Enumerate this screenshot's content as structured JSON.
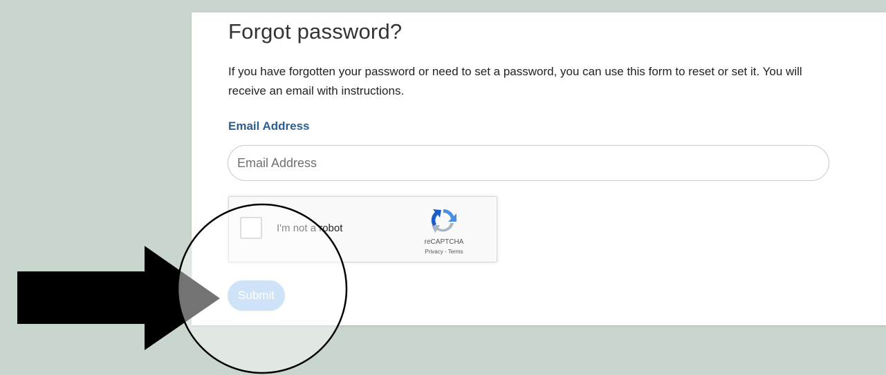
{
  "form": {
    "title": "Forgot password?",
    "description": "If you have forgotten your password or need to set a password, you can use this form to reset or set it. You will receive an email with instructions.",
    "email_label": "Email Address",
    "email_placeholder": "Email Address",
    "email_value": "",
    "submit_label": "Submit"
  },
  "recaptcha": {
    "checkbox_label": "I'm not a robot",
    "brand": "reCAPTCHA",
    "privacy_label": "Privacy",
    "separator": "-",
    "terms_label": "Terms",
    "checked": false
  },
  "icons": {
    "recaptcha_logo": "recaptcha-logo-icon",
    "annotation_arrow": "arrow-right-icon",
    "annotation_circle": "highlight-circle"
  },
  "colors": {
    "page_background": "#c9d6ce",
    "label_blue": "#2b5f8f",
    "submit_button": "#a7cdf0",
    "annotation": "#000000"
  }
}
